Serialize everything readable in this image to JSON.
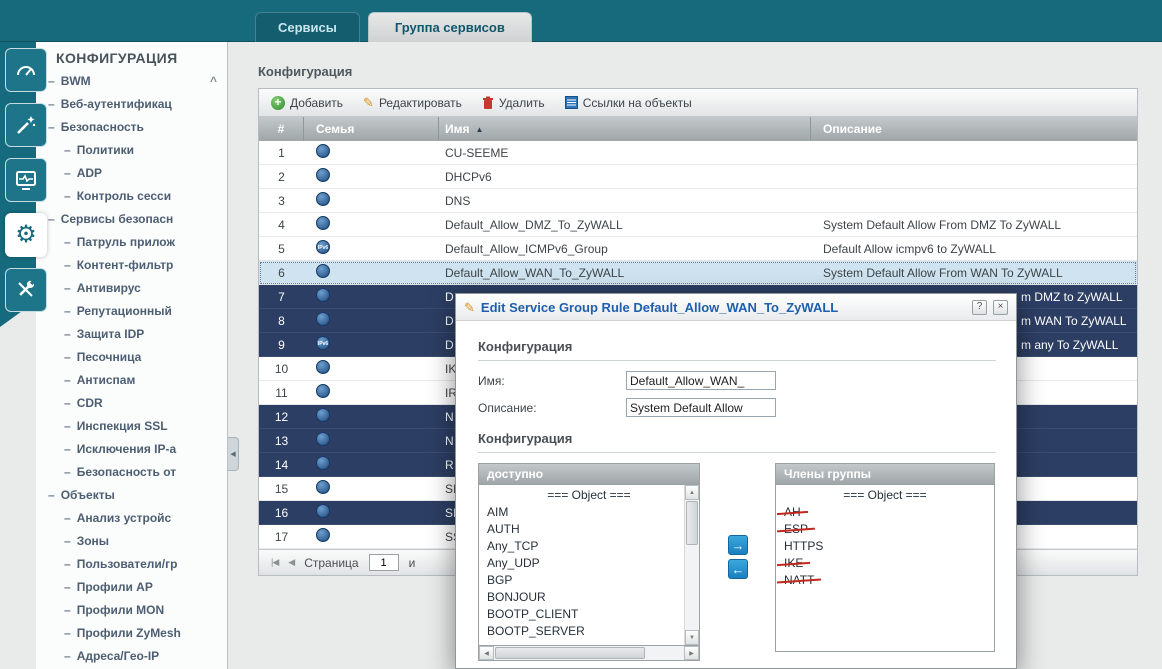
{
  "tabs": {
    "services": "Сервисы",
    "service_groups": "Группа сервисов"
  },
  "icons": {
    "sort_asc": "▲",
    "tree_dash": "–",
    "accordion_collapse": "^",
    "sidebar_collapse": "◀",
    "help": "?",
    "close": "×",
    "transfer_right": "→",
    "transfer_left": "←",
    "add_plus": "+",
    "edit_pencil": "✎",
    "first_page": "|◀",
    "prev_page": "◀",
    "scroll_up": "▲",
    "scroll_down": "▼",
    "scroll_left": "◀",
    "scroll_right": "▶"
  },
  "sidebar": {
    "header": "КОНФИГУРАЦИЯ",
    "items": [
      {
        "label": "BWM",
        "level": 1,
        "collapsible": true
      },
      {
        "label": "Веб-аутентификац",
        "level": 1
      },
      {
        "label": "Безопасность",
        "level": 1
      },
      {
        "label": "Политики",
        "level": 2
      },
      {
        "label": "ADP",
        "level": 2
      },
      {
        "label": "Контроль сесси",
        "level": 2
      },
      {
        "label": "Сервисы безопасн",
        "level": 1
      },
      {
        "label": "Патруль прилож",
        "level": 2
      },
      {
        "label": "Контент-фильтр",
        "level": 2
      },
      {
        "label": "Антивирус",
        "level": 2
      },
      {
        "label": "Репутационный",
        "level": 2
      },
      {
        "label": "Защита IDP",
        "level": 2
      },
      {
        "label": "Песочница",
        "level": 2
      },
      {
        "label": "Антиспам",
        "level": 2
      },
      {
        "label": "CDR",
        "level": 2
      },
      {
        "label": "Инспекция SSL",
        "level": 2
      },
      {
        "label": "Исключения IP-а",
        "level": 2
      },
      {
        "label": "Безопасность от",
        "level": 2
      },
      {
        "label": "Объекты",
        "level": 1
      },
      {
        "label": "Анализ устройс",
        "level": 2
      },
      {
        "label": "Зоны",
        "level": 2
      },
      {
        "label": "Пользователи/гр",
        "level": 2
      },
      {
        "label": "Профили AP",
        "level": 2
      },
      {
        "label": "Профили MON",
        "level": 2
      },
      {
        "label": "Профили ZyMesh",
        "level": 2
      },
      {
        "label": "Адреса/Гео-IP",
        "level": 2
      }
    ]
  },
  "content": {
    "section_title": "Конфигурация",
    "toolbar": [
      {
        "label": "Добавить"
      },
      {
        "label": "Редактировать"
      },
      {
        "label": "Удалить"
      },
      {
        "label": "Ссылки на объекты"
      }
    ],
    "table": {
      "columns": {
        "num": "#",
        "family": "Семья",
        "name": "Имя",
        "description": "Описание"
      },
      "rows": [
        {
          "num": "1",
          "family": "ipv4",
          "name": "CU-SEEME",
          "description": "",
          "variant": "light"
        },
        {
          "num": "2",
          "family": "ipv4",
          "name": "DHCPv6",
          "description": "",
          "variant": "light"
        },
        {
          "num": "3",
          "family": "ipv4",
          "name": "DNS",
          "description": "",
          "variant": "light"
        },
        {
          "num": "4",
          "family": "ipv4",
          "name": "Default_Allow_DMZ_To_ZyWALL",
          "description": "System Default Allow From DMZ To ZyWALL",
          "variant": "light"
        },
        {
          "num": "5",
          "family": "ipv6",
          "name": "Default_Allow_ICMPv6_Group",
          "description": "Default Allow icmpv6 to ZyWALL",
          "variant": "light"
        },
        {
          "num": "6",
          "family": "ipv4",
          "name": "Default_Allow_WAN_To_ZyWALL",
          "description": "System Default Allow From WAN To ZyWALL",
          "variant": "selected"
        },
        {
          "num": "7",
          "family": "ipv4",
          "name": "D",
          "description": "m DMZ to ZyWALL",
          "variant": "dark",
          "desc_offset": true
        },
        {
          "num": "8",
          "family": "ipv4",
          "name": "D",
          "description": "m WAN To ZyWALL",
          "variant": "dark",
          "desc_offset": true
        },
        {
          "num": "9",
          "family": "ipv6",
          "name": "D",
          "description": "m any To ZyWALL",
          "variant": "dark",
          "desc_offset": true
        },
        {
          "num": "10",
          "family": "ipv4",
          "name": "IK",
          "description": "",
          "variant": "light"
        },
        {
          "num": "11",
          "family": "ipv4",
          "name": "IR",
          "description": "",
          "variant": "light"
        },
        {
          "num": "12",
          "family": "ipv4",
          "name": "N",
          "description": "",
          "variant": "dark"
        },
        {
          "num": "13",
          "family": "ipv4",
          "name": "N",
          "description": "",
          "variant": "dark"
        },
        {
          "num": "14",
          "family": "ipv4",
          "name": "R",
          "description": "",
          "variant": "dark"
        },
        {
          "num": "15",
          "family": "ipv4",
          "name": "SI",
          "description": "",
          "variant": "light"
        },
        {
          "num": "16",
          "family": "ipv4",
          "name": "SI",
          "description": "",
          "variant": "dark"
        },
        {
          "num": "17",
          "family": "ipv4",
          "name": "SS",
          "description": "",
          "variant": "light"
        }
      ]
    },
    "pagination": {
      "label": "Страница",
      "value": "1",
      "suffix": "и"
    }
  },
  "dialog": {
    "title": "Edit Service Group Rule Default_Allow_WAN_To_ZyWALL",
    "section_config": "Конфигурация",
    "name_label": "Имя:",
    "name_value": "Default_Allow_WAN_",
    "description_label": "Описание:",
    "description_value": "System Default Allow",
    "section_members": "Конфигурация",
    "available": {
      "header": "доступно",
      "group": "=== Object ===",
      "items": [
        "AIM",
        "AUTH",
        "Any_TCP",
        "Any_UDP",
        "BGP",
        "BONJOUR",
        "BOOTP_CLIENT",
        "BOOTP_SERVER"
      ]
    },
    "members": {
      "header": "Члены группы",
      "group": "=== Object ===",
      "items": [
        {
          "label": "AH",
          "struck": true
        },
        {
          "label": "ESP",
          "struck": true
        },
        {
          "label": "HTTPS",
          "struck": false
        },
        {
          "label": "IKE",
          "struck": true
        },
        {
          "label": "NATT",
          "struck": true
        }
      ]
    }
  },
  "colors": {
    "teal_brand": "#17697c",
    "dialog_title_blue": "#1f5fae",
    "dark_row": "#2c3e63",
    "selected_row": "#cfe4f0",
    "strike_red": "#c2281c"
  }
}
